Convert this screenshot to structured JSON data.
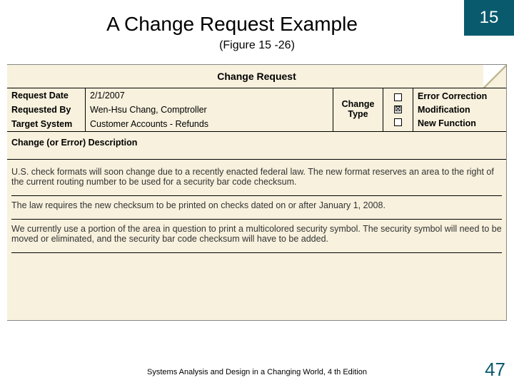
{
  "chapter_number": "15",
  "slide_title": "A Change Request Example",
  "figure_ref": "(Figure 15 -26)",
  "form": {
    "title": "Change Request",
    "fields": {
      "request_date_label": "Request Date",
      "request_date_value": "2/1/2007",
      "requested_by_label": "Requested By",
      "requested_by_value": "Wen-Hsu Chang, Comptroller",
      "target_system_label": "Target System",
      "target_system_value": "Customer Accounts - Refunds"
    },
    "change_type": {
      "label_line1": "Change",
      "label_line2": "Type",
      "options": [
        {
          "label": "Error Correction",
          "checked": false
        },
        {
          "label": "Modification",
          "checked": true
        },
        {
          "label": "New Function",
          "checked": false
        }
      ]
    },
    "description_heading": "Change (or Error) Description",
    "description_paragraphs": [
      "U.S. check formats will soon change due to a recently enacted federal law. The new format reserves an area to the right of the current routing number to be used for a security bar code checksum.",
      "The law requires the new checksum to be printed on checks dated on or after January 1, 2008.",
      "We currently use a portion of the area in question to print a multicolored security symbol. The security symbol will need to be moved or eliminated, and the security bar code checksum will have to be added."
    ]
  },
  "footer_citation": "Systems Analysis and Design in a Changing World, 4 th Edition",
  "page_number": "47",
  "checkmark_glyph": "⊠"
}
